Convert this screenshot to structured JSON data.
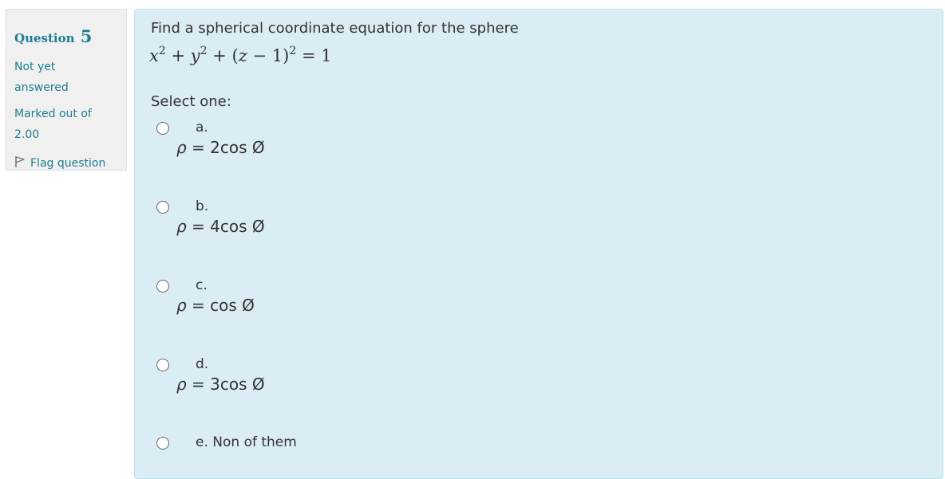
{
  "info": {
    "question_label": "Question",
    "question_number": "5",
    "state": "Not yet answered",
    "grade": "Marked out of 2.00",
    "flag_label": "Flag question"
  },
  "question": {
    "text": "Find a spherical coordinate equation for the sphere",
    "equation": {
      "x": "x",
      "y": "y",
      "z": "z",
      "exp": "2",
      "plus": "+",
      "open": "(",
      "minus": "−",
      "one": "1",
      "close": ")",
      "equals": "=",
      "rhs": "1"
    },
    "prompt": "Select one:"
  },
  "options": [
    {
      "letter": "a.",
      "rho": "ρ",
      "eq": " = 2cos Ø",
      "selected": false
    },
    {
      "letter": "b.",
      "rho": "ρ",
      "eq": " = 4cos Ø",
      "selected": false
    },
    {
      "letter": "c.",
      "rho": "ρ",
      "eq": " = cos Ø",
      "selected": false
    },
    {
      "letter": "d.",
      "rho": "ρ",
      "eq": " = 3cos Ø",
      "selected": false
    },
    {
      "letter": "e. Non of them",
      "selected": false
    }
  ]
}
